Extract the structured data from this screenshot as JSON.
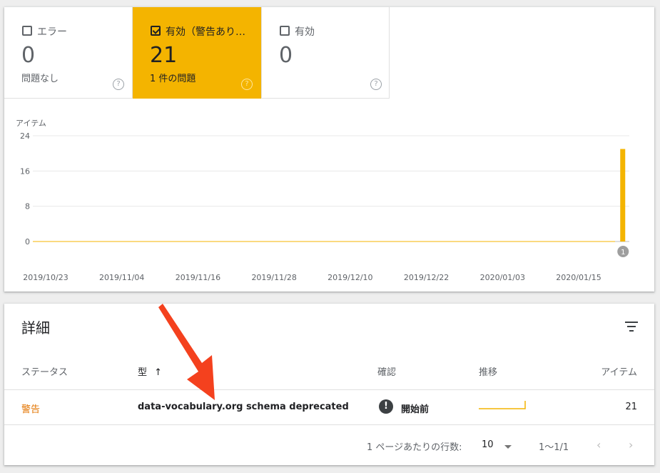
{
  "tiles": [
    {
      "label": "エラー",
      "count": "0",
      "sub": "問題なし",
      "checked": false
    },
    {
      "label": "有効（警告あり…",
      "count": "21",
      "sub": "1 件の問題",
      "checked": true
    },
    {
      "label": "有効",
      "count": "0",
      "sub": "",
      "checked": false
    }
  ],
  "help_glyph": "?",
  "chart_data": {
    "type": "bar",
    "ylabel": "アイテム",
    "ylim": [
      0,
      24
    ],
    "yticks": [
      "24",
      "16",
      "8",
      "0"
    ],
    "xticks": [
      "2019/10/23",
      "2019/11/04",
      "2019/11/16",
      "2019/11/28",
      "2019/12/10",
      "2019/12/22",
      "2020/01/03",
      "2020/01/15"
    ],
    "series": [
      {
        "values": [
          0,
          21
        ],
        "x": [
          "2019/10/23",
          "2020/01/22"
        ],
        "color": "#f4b400"
      }
    ],
    "annotation": "1"
  },
  "detail": {
    "title": "詳細",
    "columns": {
      "status": "ステータス",
      "type": "型",
      "sort_arrow": "↑",
      "confirm": "確認",
      "trend": "推移",
      "items": "アイテム"
    },
    "rows": [
      {
        "status": "警告",
        "type": "data-vocabulary.org schema deprecated",
        "confirm_icon": "!",
        "confirm": "開始前",
        "items": "21"
      }
    ],
    "footer": {
      "rows_per_page_label": "1 ページあたりの行数:",
      "rows_per_page": "10",
      "range": "1〜1/1",
      "prev": "‹",
      "next": "›"
    }
  },
  "colors": {
    "warning": "#f4b400",
    "status_warning_text": "#e37400",
    "annotation_arrow": "#f4411e"
  }
}
